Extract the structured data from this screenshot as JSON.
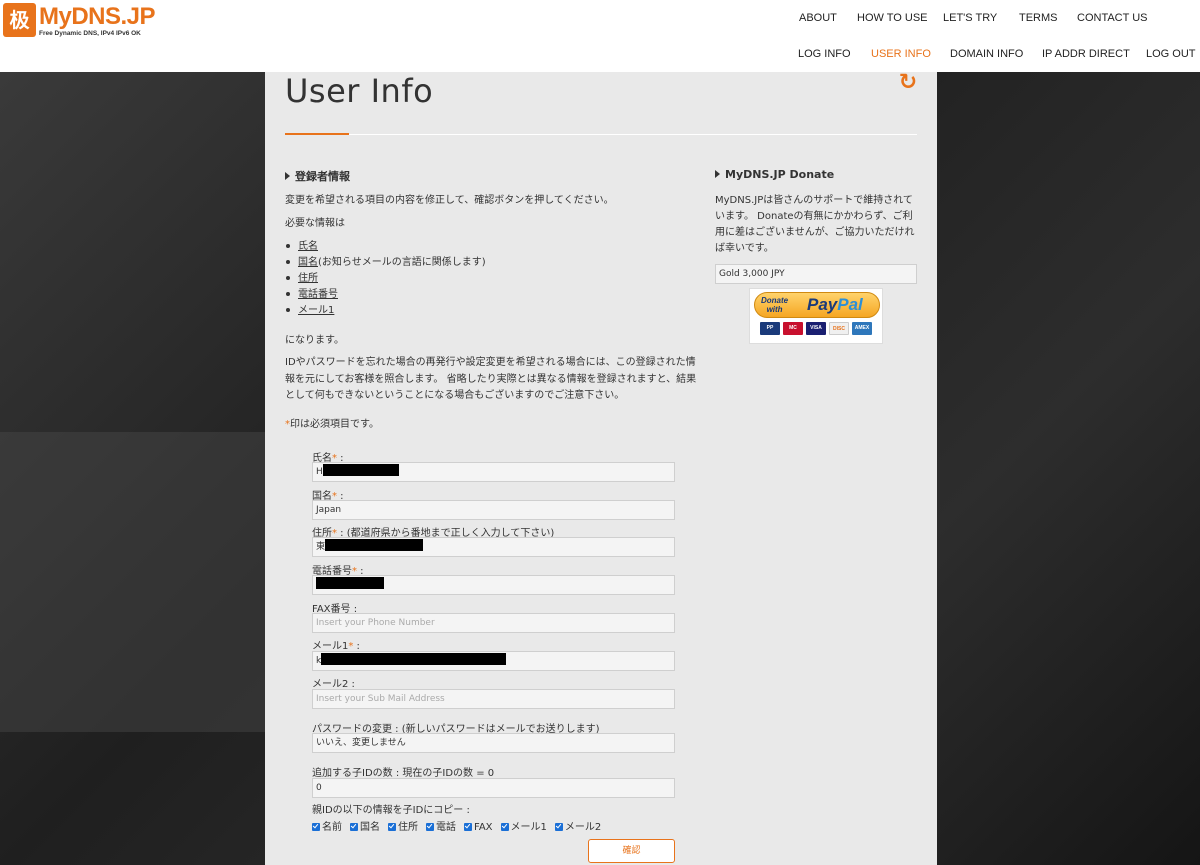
{
  "logo": {
    "mark": "极",
    "name": "MyDNS.JP",
    "tagline": "Free Dynamic DNS, IPv4 IPv6 OK"
  },
  "nav_top": [
    "ABOUT",
    "HOW TO USE",
    "LET'S TRY",
    "TERMS",
    "CONTACT US"
  ],
  "nav_bottom": [
    "LOG INFO",
    "USER INFO",
    "DOMAIN INFO",
    "IP ADDR DIRECT",
    "LOG OUT"
  ],
  "nav_active": "USER INFO",
  "colors": {
    "accent": "#e8731b",
    "panel": "#e9e9e9",
    "checkbox": "#1a6fd6"
  },
  "page": {
    "title": "User Info",
    "refresh_icon": "refresh-icon"
  },
  "registrant": {
    "heading": "登録者情報",
    "intro": "変更を希望される項目の内容を修正して、確認ボタンを押してください。",
    "required_lead": "必要な情報は",
    "required_items": [
      "氏名",
      "国名",
      "住所",
      "電話番号",
      "メール1"
    ],
    "country_note": "(お知らせメールの言語に関係します)",
    "required_tail": "になります。",
    "notice_lines": [
      "IDやパスワードを忘れた場合の再発行や設定変更を希望される場合には、この登録された情",
      "報を元にしてお客様を照合します。 省略したり実際とは異なる情報を登録されますと、結果",
      "として何もできないということになる場合もございますのでご注意下さい。"
    ],
    "required_mark": "*",
    "required_mark_note": "印は必須項目です。"
  },
  "form": {
    "name_label": "氏名",
    "name_value": "H",
    "country_label": "国名",
    "country_value": "Japan",
    "address_label": "住所",
    "address_hint": "(都道府県から番地まで正しく入力して下さい)",
    "address_value": "東",
    "phone_label": "電話番号",
    "phone_value": "",
    "fax_label": "FAX番号",
    "fax_placeholder": "Insert your Phone Number",
    "mail1_label": "メール1",
    "mail1_value": "k",
    "mail2_label": "メール2",
    "mail2_placeholder": "Insert your Sub Mail Address",
    "password_label": "パスワードの変更 : (新しいパスワードはメールでお送りします)",
    "password_value": "いいえ、変更しません",
    "child_label": "追加する子IDの数 : 現在の子IDの数 = 0",
    "child_value": "0",
    "copy_label": "親IDの以下の情報を子IDにコピー :",
    "copy_options": [
      "名前",
      "国名",
      "住所",
      "電話",
      "FAX",
      "メール1",
      "メール2"
    ],
    "confirm_label": "確認"
  },
  "donate": {
    "heading": "MyDNS.JP Donate",
    "lines": [
      "MyDNS.JPは皆さんのサポートで維持されて",
      "います。 Donateの有無にかかわらず、ご利",
      "用に差はございませんが、ご協力いただけれ",
      "ば幸いです。"
    ],
    "selected": "Gold 3,000 JPY",
    "button_top": "Donate",
    "button_with": "with",
    "brand_pay": "Pay",
    "brand_pal": "Pal",
    "cards": [
      "PayPal",
      "MasterCard",
      "VISA",
      "DISCOVER",
      "AMEX"
    ]
  }
}
